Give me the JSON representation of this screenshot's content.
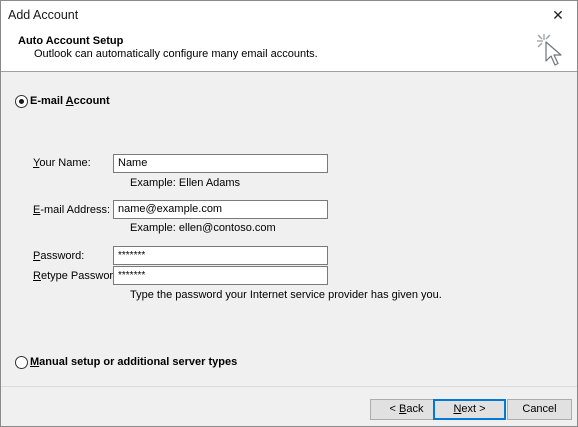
{
  "window": {
    "title": "Add Account",
    "close_glyph": "✕"
  },
  "header": {
    "title": "Auto Account Setup",
    "subtitle": "Outlook can automatically configure many email accounts.",
    "icon": "wizard-cursor-icon"
  },
  "email_option": {
    "label_prefix": "E-mail ",
    "label_accel": "A",
    "label_suffix": "ccount",
    "selected": true
  },
  "fields": {
    "name": {
      "label_accel": "Y",
      "label_rest": "our Name:",
      "value": "Name",
      "hint": "Example: Ellen Adams"
    },
    "email": {
      "label_accel": "E",
      "label_rest": "-mail Address:",
      "value": "name@example.com",
      "hint": "Example: ellen@contoso.com"
    },
    "password": {
      "label_accel": "P",
      "label_rest": "assword:",
      "value": "*******"
    },
    "retype": {
      "label_accel": "R",
      "label_rest": "etype Password:",
      "value": "*******",
      "hint": "Type the password your Internet service provider has given you."
    }
  },
  "manual_option": {
    "label_accel": "M",
    "label_rest": "anual setup or additional server types",
    "selected": false
  },
  "buttons": {
    "back_prefix": "< ",
    "back_accel": "B",
    "back_rest": "ack",
    "next_accel": "N",
    "next_rest": "ext >",
    "cancel": "Cancel"
  }
}
